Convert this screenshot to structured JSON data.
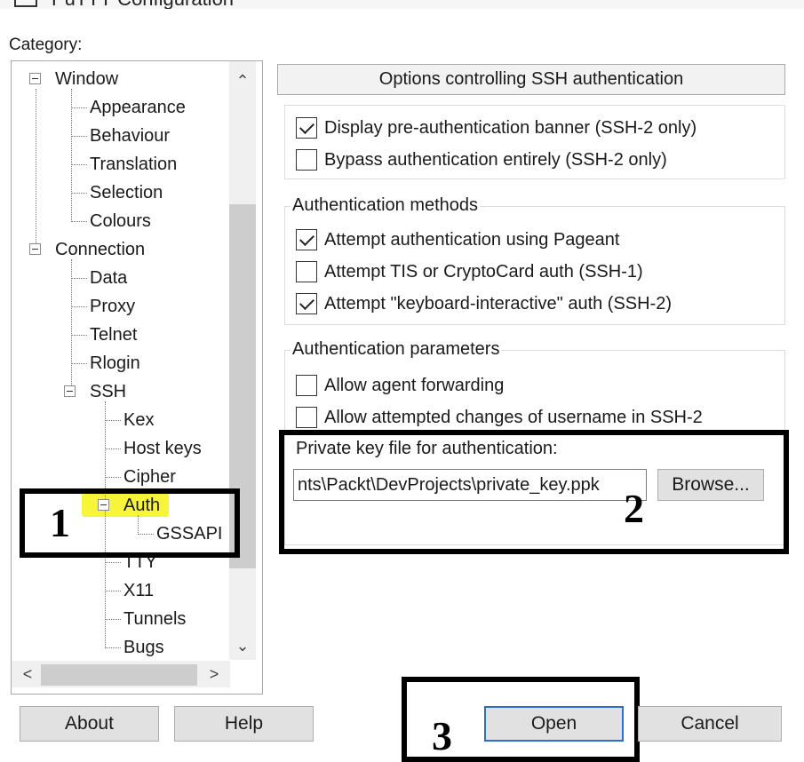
{
  "window": {
    "title": "PuTTY Configuration"
  },
  "category_label": "Category:",
  "tree": {
    "window": "Window",
    "appearance": "Appearance",
    "behaviour": "Behaviour",
    "translation": "Translation",
    "selection": "Selection",
    "colours": "Colours",
    "connection": "Connection",
    "data": "Data",
    "proxy": "Proxy",
    "telnet": "Telnet",
    "rlogin": "Rlogin",
    "ssh": "SSH",
    "kex": "Kex",
    "host_keys": "Host keys",
    "cipher": "Cipher",
    "auth": "Auth",
    "gssapi": "GSSAPI",
    "tty": "TTY",
    "x11": "X11",
    "tunnels": "Tunnels",
    "bugs": "Bugs"
  },
  "scroll": {
    "up": "⌃",
    "down": "⌄",
    "left": "<",
    "right": ">"
  },
  "options_header": "Options controlling SSH authentication",
  "banner_group": {
    "items": [
      {
        "label": "Display pre-authentication banner (SSH-2 only)",
        "checked": true
      },
      {
        "label": "Bypass authentication entirely (SSH-2 only)",
        "checked": false
      }
    ]
  },
  "methods_group": {
    "title": "Authentication methods",
    "items": [
      {
        "label": "Attempt authentication using Pageant",
        "checked": true
      },
      {
        "label": "Attempt TIS or CryptoCard auth (SSH-1)",
        "checked": false
      },
      {
        "label": "Attempt \"keyboard-interactive\" auth (SSH-2)",
        "checked": true
      }
    ]
  },
  "params_group": {
    "title": "Authentication parameters",
    "items": [
      {
        "label": "Allow agent forwarding",
        "checked": false
      },
      {
        "label": "Allow attempted changes of username in SSH-2",
        "checked": false
      }
    ],
    "private_key_label": "Private key file for authentication:",
    "private_key_value": "nts\\Packt\\DevProjects\\private_key.ppk",
    "browse_label": "Browse..."
  },
  "annotations": {
    "one": "1",
    "two": "2",
    "three": "3"
  },
  "buttons": {
    "about": "About",
    "help": "Help",
    "open": "Open",
    "cancel": "Cancel"
  }
}
